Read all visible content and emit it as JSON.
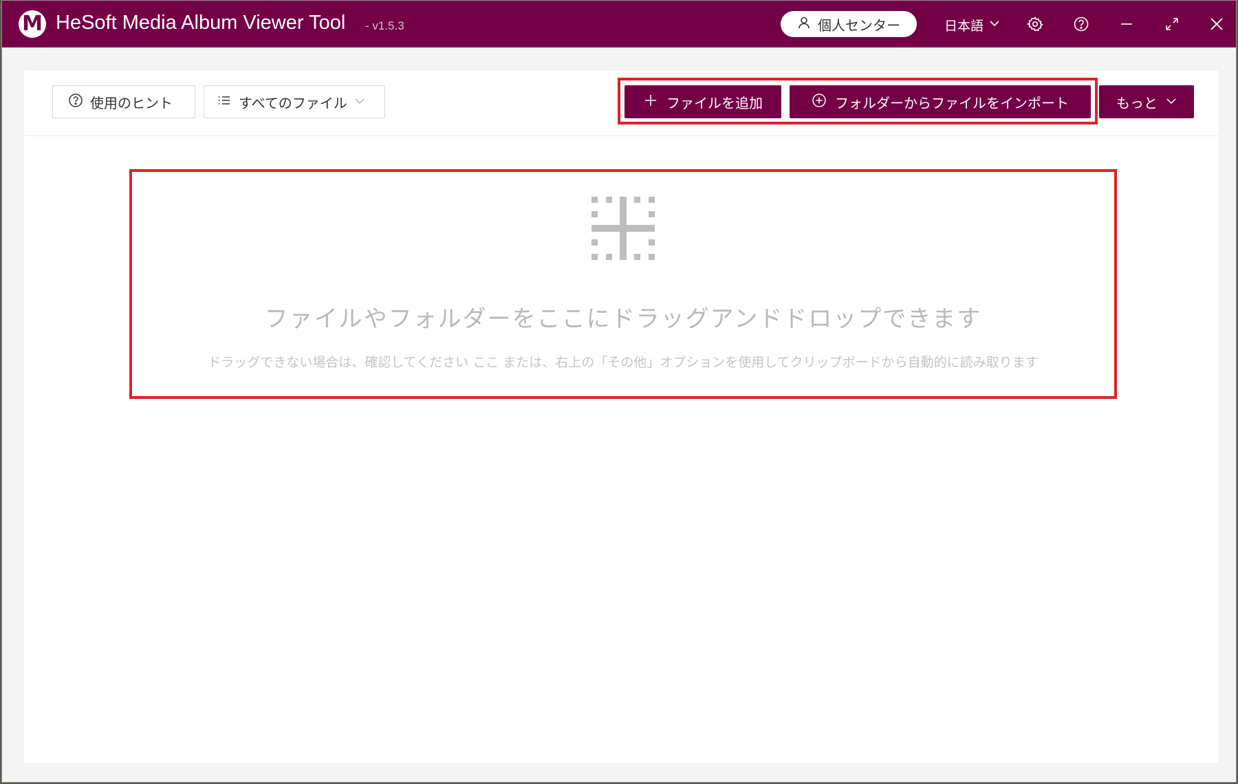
{
  "titlebar": {
    "logo_letter": "M",
    "title": "HeSoft Media Album Viewer Tool",
    "version": "- v1.5.3",
    "user_center_label": "個人センター",
    "language_label": "日本語",
    "icons": [
      "user-icon",
      "chevron-down-icon",
      "gear-icon",
      "help-icon",
      "minimize-icon",
      "maximize-icon",
      "close-icon"
    ]
  },
  "toolbar": {
    "tips_label": "使用のヒント",
    "filter_label": "すべてのファイル",
    "add_file_label": "ファイルを追加",
    "import_folder_label": "フォルダーからファイルをインポート",
    "more_label": "もっと"
  },
  "dropzone": {
    "title": "ファイルやフォルダーをここにドラッグアンドドロップできます",
    "hint": "ドラッグできない場合は、確認してください ここ または、右上の「その他」オプションを使用してクリップボードから自動的に読み取ります"
  },
  "colors": {
    "brand": "#730046",
    "highlight": "#e0202a",
    "placeholder_text": "#b9b9b9"
  }
}
